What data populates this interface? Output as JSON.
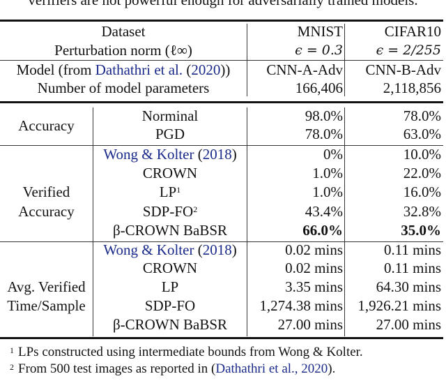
{
  "caption_tail": "verifiers are not powerful enough for adversarially trained models.",
  "header": {
    "dataset_label": "Dataset",
    "norm_label": "Perturbation norm (ℓ∞)",
    "model_label_prefix": "Model (from ",
    "model_label_link": "Dathathri et al.",
    "model_label_year": "2020",
    "model_label_suffix": "))",
    "params_label": "Number of model parameters",
    "columns": [
      {
        "dataset": "MNIST",
        "epsilon": "ϵ = 0.3",
        "model": "CNN-A-Adv",
        "params": "166,406"
      },
      {
        "dataset": "CIFAR10",
        "epsilon": "ϵ = 2/255",
        "model": "CNN-B-Adv",
        "params": "2,118,856"
      }
    ]
  },
  "groups": [
    {
      "label_lines": [
        "Accuracy"
      ],
      "rows": [
        {
          "method": "Norminal",
          "sup": "",
          "values": [
            "98.0%",
            "78.0%"
          ],
          "bold": false
        },
        {
          "method": "PGD",
          "sup": "",
          "values": [
            "78.0%",
            "63.0%"
          ],
          "bold": false
        }
      ]
    },
    {
      "label_lines": [
        "Verified",
        "Accuracy"
      ],
      "rows": [
        {
          "method_link": "Wong & Kolter",
          "method_year": "2018",
          "values": [
            "0%",
            "10.0%"
          ],
          "bold": false
        },
        {
          "method": "CROWN",
          "sup": "",
          "values": [
            "1.0%",
            "22.0%"
          ],
          "bold": false
        },
        {
          "method": "LP",
          "sup": "1",
          "values": [
            "1.0%",
            "16.0%"
          ],
          "bold": false
        },
        {
          "method": "SDP-FO",
          "sup": "2",
          "values": [
            "43.4%",
            "32.8%"
          ],
          "bold": false
        },
        {
          "method": "β-CROWN BaBSR",
          "sup": "",
          "values": [
            "66.0%",
            "35.0%"
          ],
          "bold": true
        }
      ]
    },
    {
      "label_lines": [
        "Avg. Verified",
        "Time/Sample"
      ],
      "rows": [
        {
          "method_link": "Wong & Kolter",
          "method_year": "2018",
          "values": [
            "0.02 mins",
            "0.11 mins"
          ],
          "bold": false
        },
        {
          "method": "CROWN",
          "sup": "",
          "values": [
            "0.02 mins",
            "0.11 mins"
          ],
          "bold": false
        },
        {
          "method": "LP",
          "sup": "",
          "values": [
            "3.35 mins",
            "64.30 mins"
          ],
          "bold": false
        },
        {
          "method": "SDP-FO",
          "sup": "",
          "values": [
            "1,274.38 mins",
            "1,926.21 mins"
          ],
          "bold": false
        },
        {
          "method": "β-CROWN BaBSR",
          "sup": "",
          "values": [
            "27.00 mins",
            "27.00 mins"
          ],
          "bold": false
        }
      ]
    }
  ],
  "footnotes": [
    {
      "mark": "1",
      "text": "LPs constructed using intermediate bounds from Wong & Kolter."
    },
    {
      "mark": "2",
      "text_prefix": "From 500 test images as reported in (",
      "link": "Dathathri et al., 2020",
      "text_suffix": ")."
    }
  ],
  "colors": {
    "link": "#1a2a8a",
    "text": "#111111"
  }
}
